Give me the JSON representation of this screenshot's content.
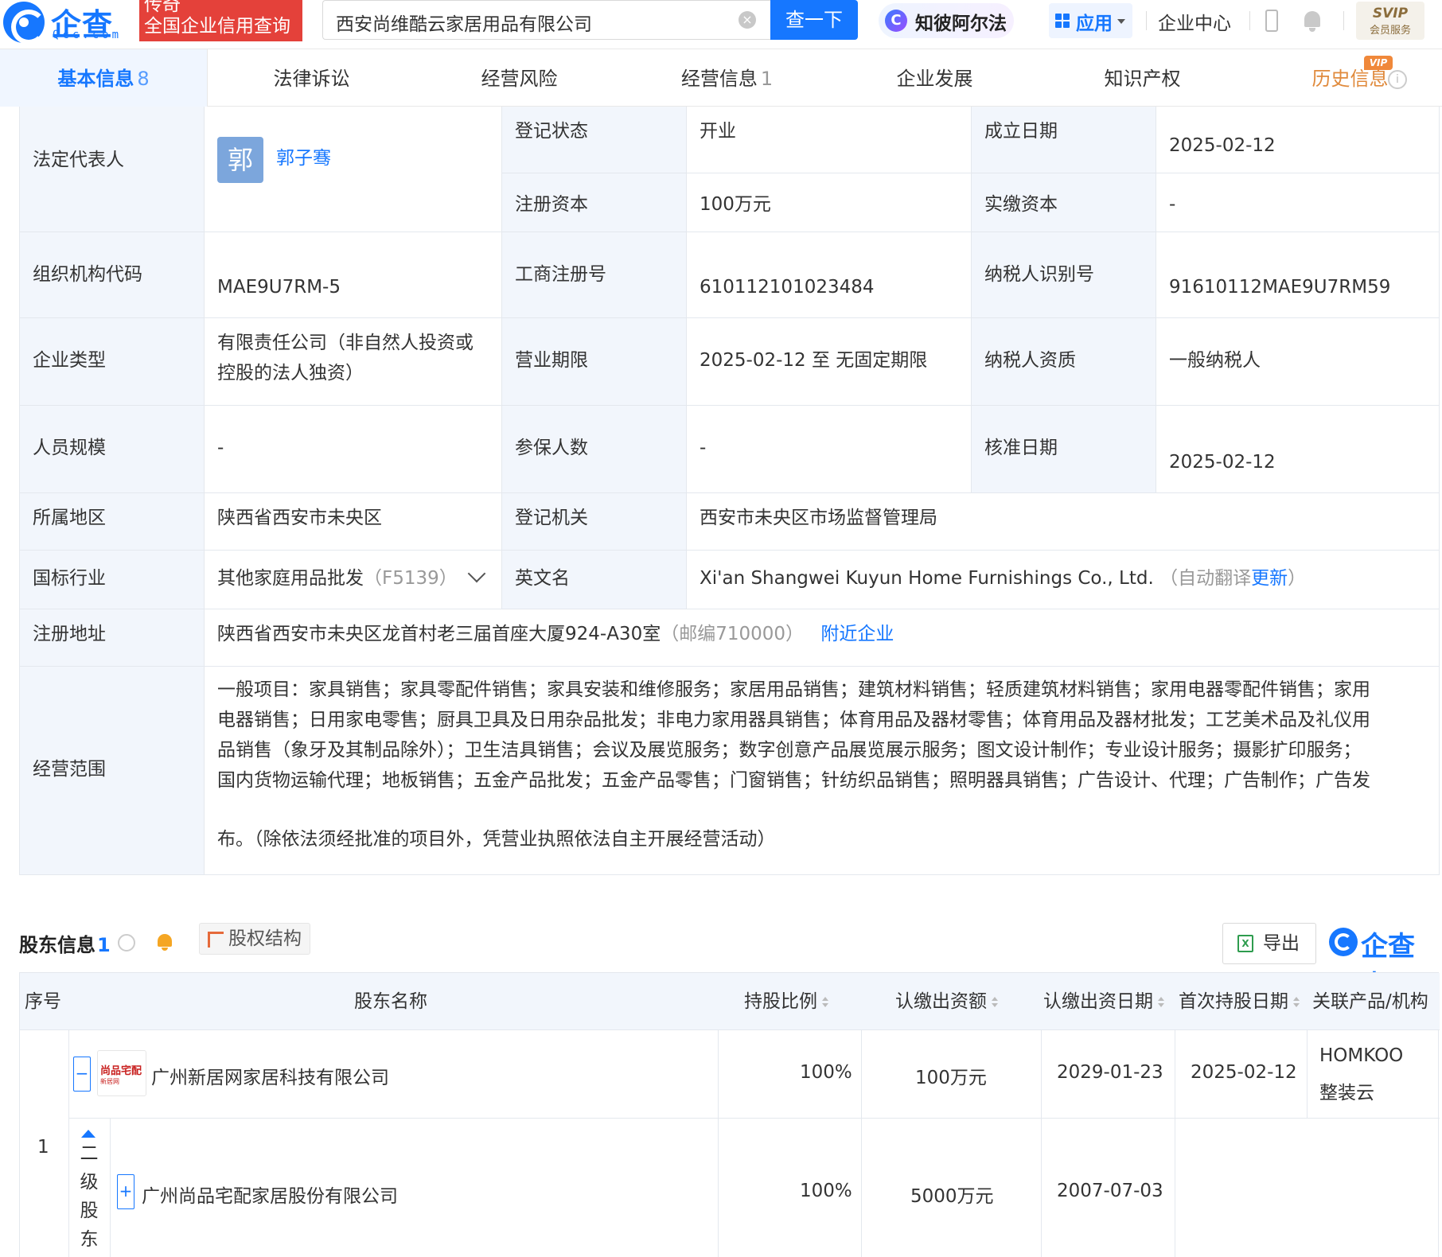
{
  "header": {
    "logo_name": "企查查",
    "logo_domain": "Qcc.com",
    "badge_line1": "传奇",
    "badge_line2": "全国企业信用查询",
    "search_value": "西安尚维酷云家居用品有限公司",
    "search_button": "查一下",
    "ai_label": "知彼阿尔法",
    "app_label": "应用",
    "enterprise_center": "企业中心",
    "svip_line1": "SVIP",
    "svip_line2": "会员服务"
  },
  "tabs": [
    {
      "label": "基本信息",
      "count": "8"
    },
    {
      "label": "法律诉讼",
      "count": ""
    },
    {
      "label": "经营风险",
      "count": ""
    },
    {
      "label": "经营信息",
      "count": "1"
    },
    {
      "label": "企业发展",
      "count": ""
    },
    {
      "label": "知识产权",
      "count": ""
    },
    {
      "label": "历史信息",
      "count": ""
    }
  ],
  "vip_tag": "VIP",
  "info": {
    "legal_rep_label": "法定代表人",
    "legal_rep_avatar": "郭",
    "legal_rep_name": "郭子骞",
    "reg_status_label": "登记状态",
    "reg_status": "开业",
    "found_date_label": "成立日期",
    "found_date": "2025-02-12",
    "reg_capital_label": "注册资本",
    "reg_capital": "100万元",
    "paid_capital_label": "实缴资本",
    "paid_capital": "-",
    "org_code_label": "组织机构代码",
    "org_code": "MAE9U7RM-5",
    "biz_reg_no_label": "工商注册号",
    "biz_reg_no": "610112101023484",
    "taxpayer_id_label": "纳税人识别号",
    "taxpayer_id": "91610112MAE9U7RM59",
    "ent_type_label": "企业类型",
    "ent_type_line1": "有限责任公司（非自然人投资或",
    "ent_type_line2": "控股的法人独资）",
    "biz_term_label": "营业期限",
    "biz_term": "2025-02-12 至 无固定期限",
    "taxpayer_qual_label": "纳税人资质",
    "taxpayer_qual": "一般纳税人",
    "staff_size_label": "人员规模",
    "staff_size": "-",
    "insured_label": "参保人数",
    "insured": "-",
    "approve_date_label": "核准日期",
    "approve_date": "2025-02-12",
    "region_label": "所属地区",
    "region": "陕西省西安市未央区",
    "reg_authority_label": "登记机关",
    "reg_authority": "西安市未央区市场监督管理局",
    "industry_label": "国标行业",
    "industry": "其他家庭用品批发",
    "industry_code": "（F5139）",
    "en_name_label": "英文名",
    "en_name": "Xi'an Shangwei Kuyun Home Furnishings Co., Ltd.",
    "en_name_note_prefix": "（自动翻译",
    "en_name_update": "更新",
    "en_name_note_suffix": "）",
    "reg_address_label": "注册地址",
    "reg_address": "陕西省西安市未央区龙首村老三届首座大厦924-A30室",
    "postcode": "（邮编710000）",
    "nearby_link": "附近企业",
    "scope_label": "经营范围",
    "scope_lines": [
      "一般项目：家具销售；家具零配件销售；家具安装和维修服务；家居用品销售；建筑材料销售；轻质建筑材料销售；家用电器零配件销售；家用",
      "电器销售；日用家电零售；厨具卫具及日用杂品批发；非电力家用器具销售；体育用品及器材零售；体育用品及器材批发；工艺美术品及礼仪用",
      "品销售（象牙及其制品除外）；卫生洁具销售；会议及展览服务；数字创意产品展览展示服务；图文设计制作；专业设计服务；摄影扩印服务；",
      "国内货物运输代理；地板销售；五金产品批发；五金产品零售；门窗销售；针纺织品销售；照明器具销售；广告设计、代理；广告制作；广告发",
      "布。（除依法须经批准的项目外，凭营业执照依法自主开展经营活动）"
    ]
  },
  "shareholders": {
    "title": "股东信息",
    "count": "1",
    "equity_button": "股权结构",
    "export_button": "导出",
    "watermark_name": "企查查",
    "columns": [
      "序号",
      "股东名称",
      "持股比例",
      "认缴出资额",
      "认缴出资日期",
      "首次持股日期",
      "关联产品/机构"
    ],
    "row_index": "1",
    "row": {
      "name": "广州新居网家居科技有限公司",
      "logo_line1": "尚品宅配",
      "logo_line2": "新居网",
      "ratio": "100%",
      "amount": "100万元",
      "sub_date": "2029-01-23",
      "first_date": "2025-02-12",
      "product_line1": "HOMKOO",
      "product_line2": "整装云"
    },
    "second_level_label": [
      "二",
      "级",
      "股",
      "东"
    ],
    "second_level": {
      "name": "广州尚品宅配家居股份有限公司",
      "ratio": "100%",
      "amount": "5000万元",
      "sub_date": "2007-07-03"
    },
    "minus_sign": "−",
    "plus_sign": "+"
  }
}
